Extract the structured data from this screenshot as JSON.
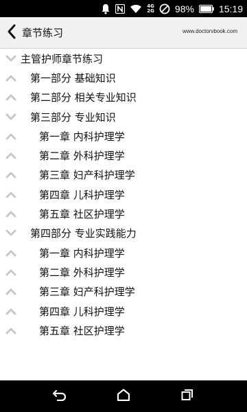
{
  "status_bar": {
    "battery": "98%",
    "time": "15:19",
    "network_top": "4G",
    "network_bottom": "2G",
    "icons": [
      "notification-bell-icon",
      "nfc-icon",
      "wifi-icon",
      "do-not-disturb-icon",
      "battery-icon"
    ]
  },
  "header": {
    "title": "章节练习",
    "site": "www.doctorvbook.com",
    "back_icon": "chevron-left-icon"
  },
  "tree": [
    {
      "label": "主管护师章节练习",
      "level": 0,
      "state": "expanded"
    },
    {
      "label": "第一部分 基础知识",
      "level": 1,
      "state": "collapsed"
    },
    {
      "label": "第二部分 相关专业知识",
      "level": 1,
      "state": "collapsed"
    },
    {
      "label": "第三部分 专业知识",
      "level": 1,
      "state": "expanded"
    },
    {
      "label": "第一章 内科护理学",
      "level": 2,
      "state": "collapsed"
    },
    {
      "label": "第二章 外科护理学",
      "level": 2,
      "state": "collapsed"
    },
    {
      "label": "第三章 妇产科护理学",
      "level": 2,
      "state": "collapsed"
    },
    {
      "label": "第四章 儿科护理学",
      "level": 2,
      "state": "collapsed"
    },
    {
      "label": "第五章 社区护理学",
      "level": 2,
      "state": "collapsed"
    },
    {
      "label": "第四部分 专业实践能力",
      "level": 1,
      "state": "expanded"
    },
    {
      "label": "第一章 内科护理学",
      "level": 2,
      "state": "collapsed"
    },
    {
      "label": "第二章 外科护理学",
      "level": 2,
      "state": "collapsed"
    },
    {
      "label": "第三章 妇产科护理学",
      "level": 2,
      "state": "collapsed"
    },
    {
      "label": "第四章 儿科护理学",
      "level": 2,
      "state": "collapsed"
    },
    {
      "label": "第五章 社区护理学",
      "level": 2,
      "state": "collapsed"
    }
  ],
  "nav_bar": {
    "icons": [
      "back-arrow-icon",
      "home-icon",
      "recent-apps-icon"
    ]
  },
  "colors": {
    "status_bar_bg": "#000000",
    "header_bg": "#f1f1f1",
    "chevron": "#c8c8c8",
    "text": "#111111"
  }
}
